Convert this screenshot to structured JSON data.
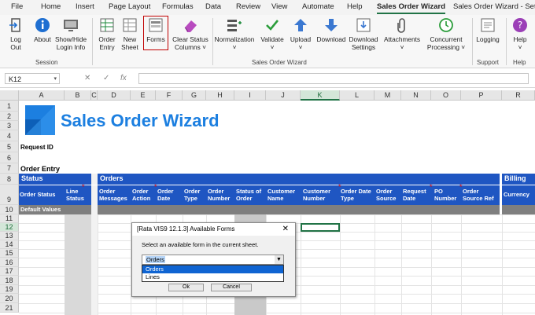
{
  "tabs": [
    "File",
    "Home",
    "Insert",
    "Page Layout",
    "Formulas",
    "Data",
    "Review",
    "View",
    "Automate",
    "Help",
    "Sales Order Wizard",
    "Sales Order Wizard - Setu"
  ],
  "active_tab": "Sales Order Wizard",
  "ribbon": {
    "buttons": [
      {
        "label": "Log\nOut",
        "icon": "logout-icon"
      },
      {
        "label": "About",
        "icon": "info-icon"
      },
      {
        "label": "Show/Hide\nLogin Info",
        "icon": "monitor-icon"
      },
      {
        "label": "Order\nEntry",
        "icon": "order-entry-icon"
      },
      {
        "label": "New\nSheet",
        "icon": "new-sheet-icon"
      },
      {
        "label": "Forms",
        "icon": "forms-icon"
      },
      {
        "label": "Clear Status\nColumns ˅",
        "icon": "eraser-icon"
      },
      {
        "label": "Normalization\n˅",
        "icon": "normalization-icon"
      },
      {
        "label": "Validate\n˅",
        "icon": "checkmark-icon"
      },
      {
        "label": "Upload\n˅",
        "icon": "upload-arrow-icon"
      },
      {
        "label": "Download",
        "icon": "download-arrow-icon"
      },
      {
        "label": "Download\nSettings",
        "icon": "download-settings-icon"
      },
      {
        "label": "Attachments\n˅",
        "icon": "paperclip-icon"
      },
      {
        "label": "Concurrent\nProcessing ˅",
        "icon": "concurrent-clock-icon"
      },
      {
        "label": "Logging",
        "icon": "logging-icon"
      },
      {
        "label": "Help\n˅",
        "icon": "help-icon"
      }
    ],
    "groups": [
      "Session",
      "Sales Order Wizard",
      "Support",
      "Help"
    ]
  },
  "formula_bar": {
    "name_box": "K12",
    "cancel": "✕",
    "enter": "✓",
    "fx": "fx",
    "value": ""
  },
  "columns": [
    "A",
    "B",
    "C",
    "D",
    "E",
    "F",
    "G",
    "H",
    "I",
    "J",
    "K",
    "L",
    "M",
    "N",
    "O",
    "P",
    "R"
  ],
  "selected_column": "K",
  "rows": [
    "1",
    "2",
    "3",
    "4",
    "5",
    "6",
    "7",
    "8",
    "9",
    "10",
    "11",
    "12",
    "13",
    "14",
    "15",
    "16",
    "17",
    "18",
    "19",
    "20",
    "21"
  ],
  "selected_row": "12",
  "sheet": {
    "logo_title": "Sales Order Wizard",
    "request_id_label": "Request ID",
    "order_entry_label": "Order Entry",
    "status_header": "Status",
    "orders_header": "Orders",
    "billing_header": "Billing",
    "status_cols": [
      "Order Status",
      "Line\nStatus"
    ],
    "order_cols": [
      "Order\nMessages",
      "Order\nAction",
      "Order\nDate",
      "Order\nType",
      "Order\nNumber",
      "Status of\nOrder",
      "Customer\nName",
      "Customer\nNumber",
      "Order Date\nType",
      "Order\nSource",
      "Request\nDate",
      "PO\nNumber",
      "Order\nSource Ref"
    ],
    "billing_cols": [
      "Currency"
    ],
    "default_values": "Default Values",
    "required_marker": "*"
  },
  "dialog": {
    "title": "[Rata VIS9 12.1.3] Available Forms",
    "close": "✕",
    "prompt": "Select an available form in the current sheet.",
    "selected": "Orders",
    "options": [
      "Orders",
      "Lines"
    ],
    "ok_label": "Ok",
    "cancel_label": "Cancel"
  },
  "colors": {
    "accent": "#217346",
    "header_blue": "#1f56c2",
    "logo_blue": "#1c7fe0",
    "default_gray": "#7f7f7f",
    "required_red": "#e00000"
  }
}
